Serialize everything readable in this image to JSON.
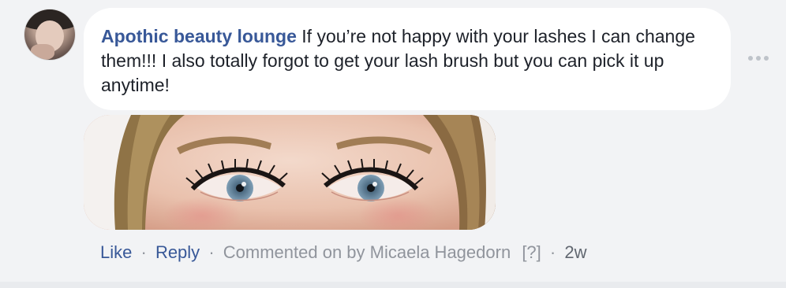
{
  "comment": {
    "author": "Apothic beauty lounge",
    "text": "If you’re not happy with your lashes I can change them!!! I also totally forgot to get your lash brush but you can pick it up anytime!"
  },
  "actions": {
    "like": "Like",
    "reply": "Reply",
    "commented_on_by": "Commented on by Micaela Hagedorn",
    "help": "[?]",
    "timestamp": "2w",
    "separator": "·"
  },
  "icons": {
    "more": "more-options-icon"
  },
  "colors": {
    "author_link": "#385898",
    "text": "#1d2129",
    "meta": "#90949c",
    "bubble_bg": "#ffffff",
    "page_bg": "#f2f3f5"
  }
}
